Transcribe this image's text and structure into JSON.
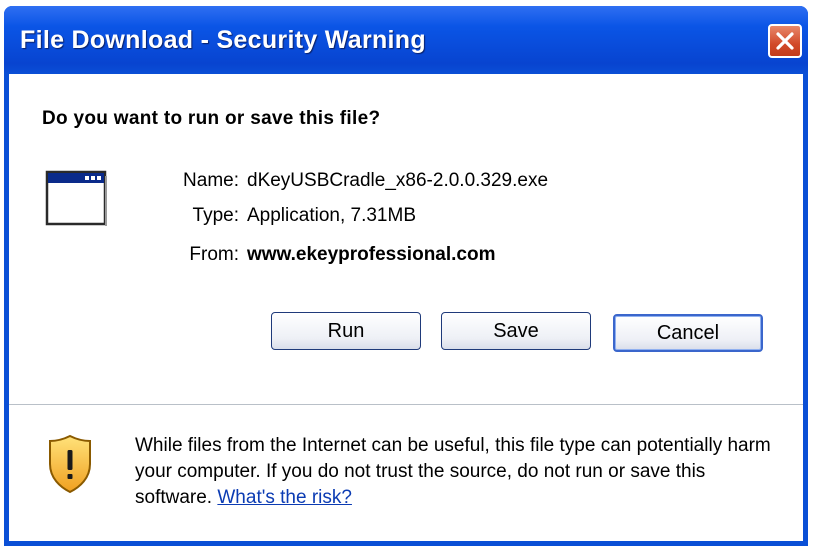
{
  "window": {
    "title": "File Download - Security Warning"
  },
  "dialog": {
    "question": "Do you want to run or save this file?",
    "file": {
      "name_label": "Name:",
      "name_value": "dKeyUSBCradle_x86-2.0.0.329.exe",
      "type_label": "Type:",
      "type_value": "Application, 7.31MB",
      "from_label": "From:",
      "from_value": "www.ekeyprofessional.com"
    },
    "buttons": {
      "run": "Run",
      "save": "Save",
      "cancel": "Cancel"
    },
    "warning": {
      "text": "While files from the Internet can be useful, this file type can potentially harm your computer. If you do not trust the source, do not run or save this software.",
      "link": "What's the risk?"
    }
  },
  "colors": {
    "titlebar": "#0a4fd6",
    "close_button": "#d24a2a",
    "link": "#0b3bb3"
  },
  "icons": [
    "close-icon",
    "application-window-icon",
    "security-shield-icon"
  ]
}
